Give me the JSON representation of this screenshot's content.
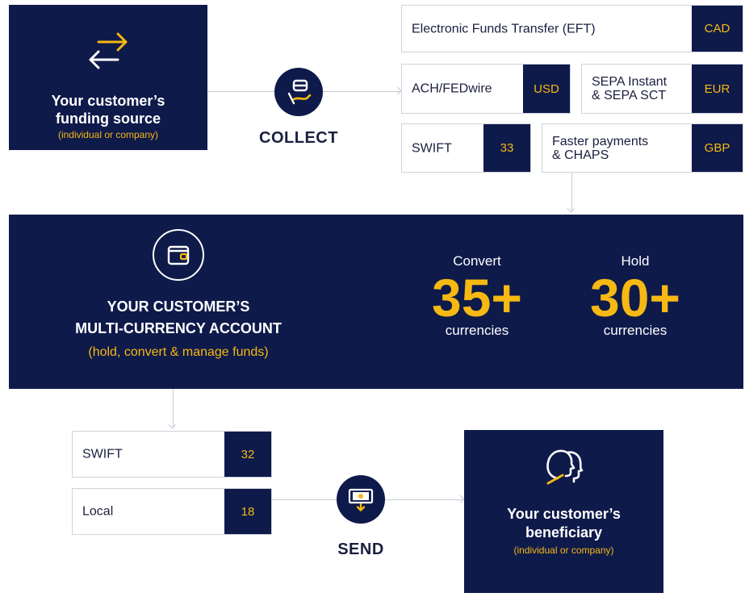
{
  "source": {
    "title_line1": "Your customer’s",
    "title_line2": "funding source",
    "subtitle": "(individual or company)",
    "icon": "transfer-arrows-icon"
  },
  "collect": {
    "label": "COLLECT",
    "icon": "hand-card-icon"
  },
  "collect_methods": [
    {
      "name": "Electronic Funds Transfer (EFT)",
      "value": "CAD"
    },
    {
      "name": "ACH/FEDwire",
      "value": "USD"
    },
    {
      "name_line1": "SEPA Instant",
      "name_line2": "& SEPA SCT",
      "value": "EUR"
    },
    {
      "name": "SWIFT",
      "value": "33"
    },
    {
      "name_line1": "Faster payments",
      "name_line2": "& CHAPS",
      "value": "GBP"
    }
  ],
  "account": {
    "title_line1": "YOUR CUSTOMER’S",
    "title_line2": "MULTI-CURRENCY ACCOUNT",
    "subtitle": "(hold, convert & manage funds)",
    "icon": "wallet-icon",
    "stats": [
      {
        "label": "Convert",
        "value": "35+",
        "unit": "currencies"
      },
      {
        "label": "Hold",
        "value": "30+",
        "unit": "currencies"
      }
    ]
  },
  "send_methods": [
    {
      "name": "SWIFT",
      "value": "32"
    },
    {
      "name": "Local",
      "value": "18"
    }
  ],
  "send": {
    "label": "SEND",
    "icon": "banknote-down-icon"
  },
  "beneficiary": {
    "title_line1": "Your customer’s",
    "title_line2": "beneficiary",
    "subtitle": "(individual or company)",
    "icon": "people-heads-icon"
  },
  "colors": {
    "navy": "#0e1a4a",
    "accent": "#f6b812",
    "border": "#cfd3dc"
  }
}
